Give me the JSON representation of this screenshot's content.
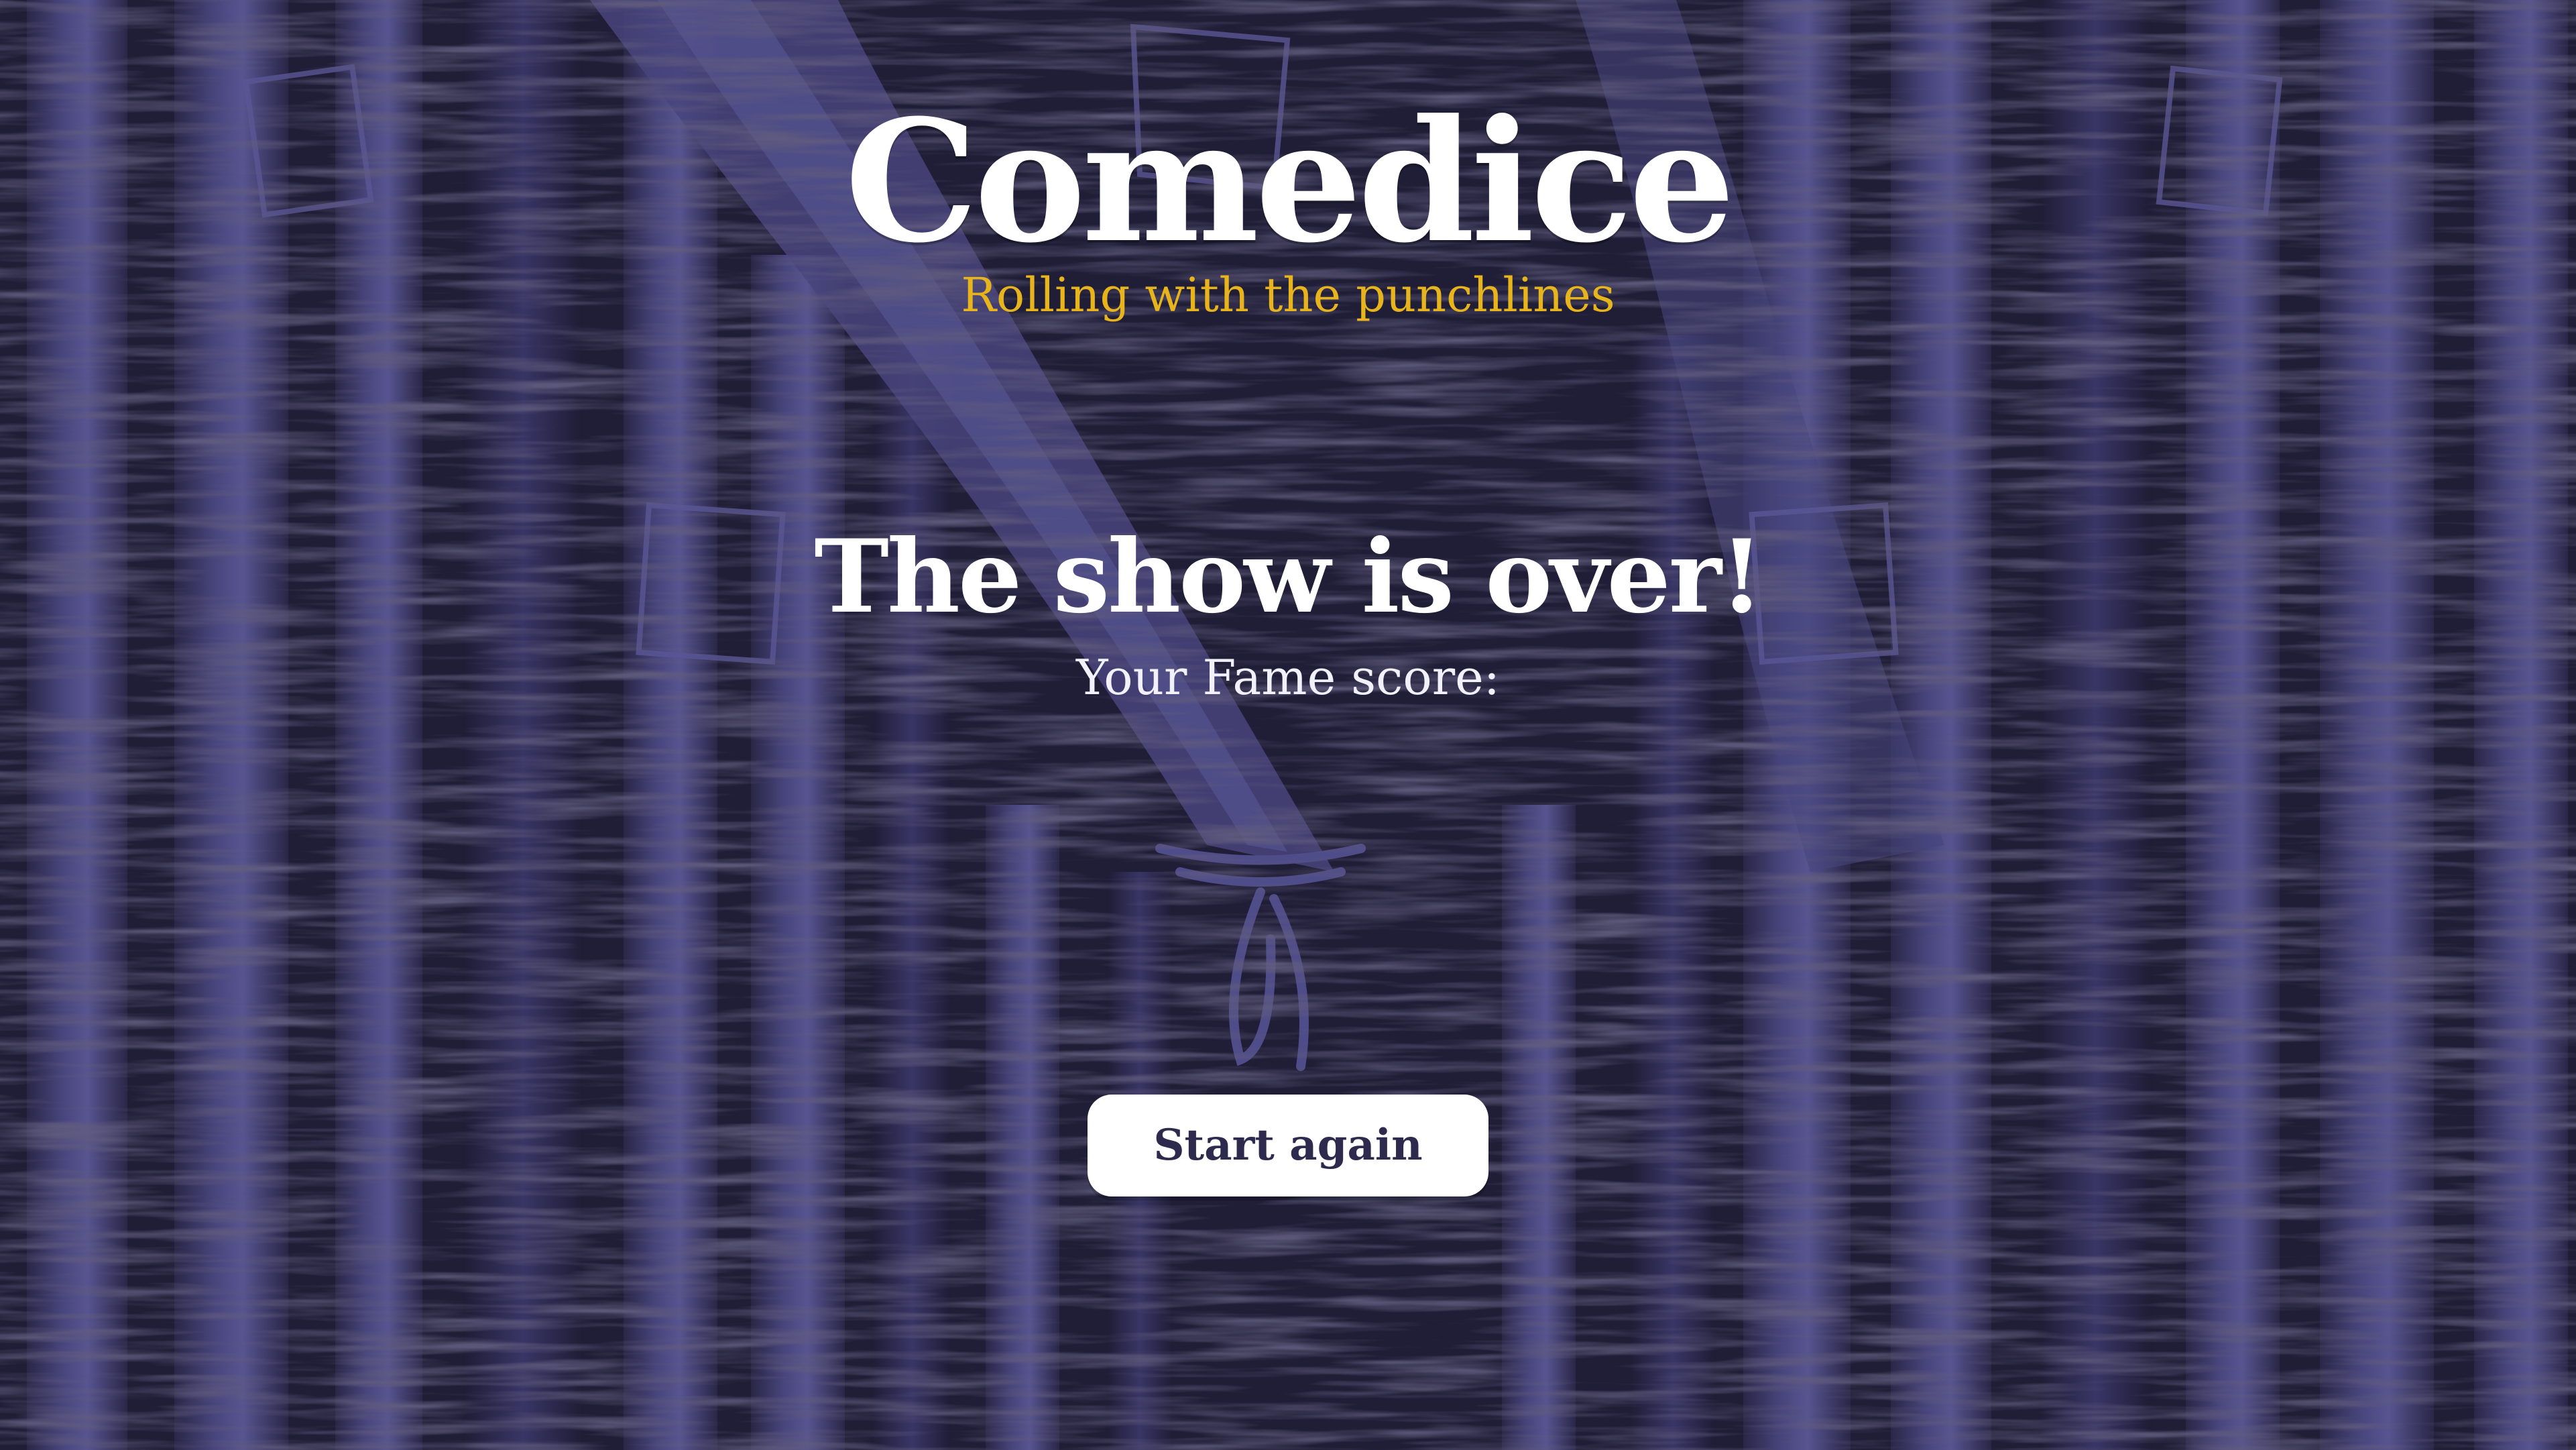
{
  "header": {
    "title": "Comedice",
    "subtitle": "Rolling with the punchlines"
  },
  "end_screen": {
    "heading": "The show is over!",
    "score_label": "Your Fame score:",
    "restart_label": "Start again"
  },
  "colors": {
    "background": "#201d36",
    "curtain_light": "#4d4a85",
    "curtain_mid": "#3a3768",
    "subtitle": "#e8b41c",
    "button_text": "#2e2a4e"
  }
}
